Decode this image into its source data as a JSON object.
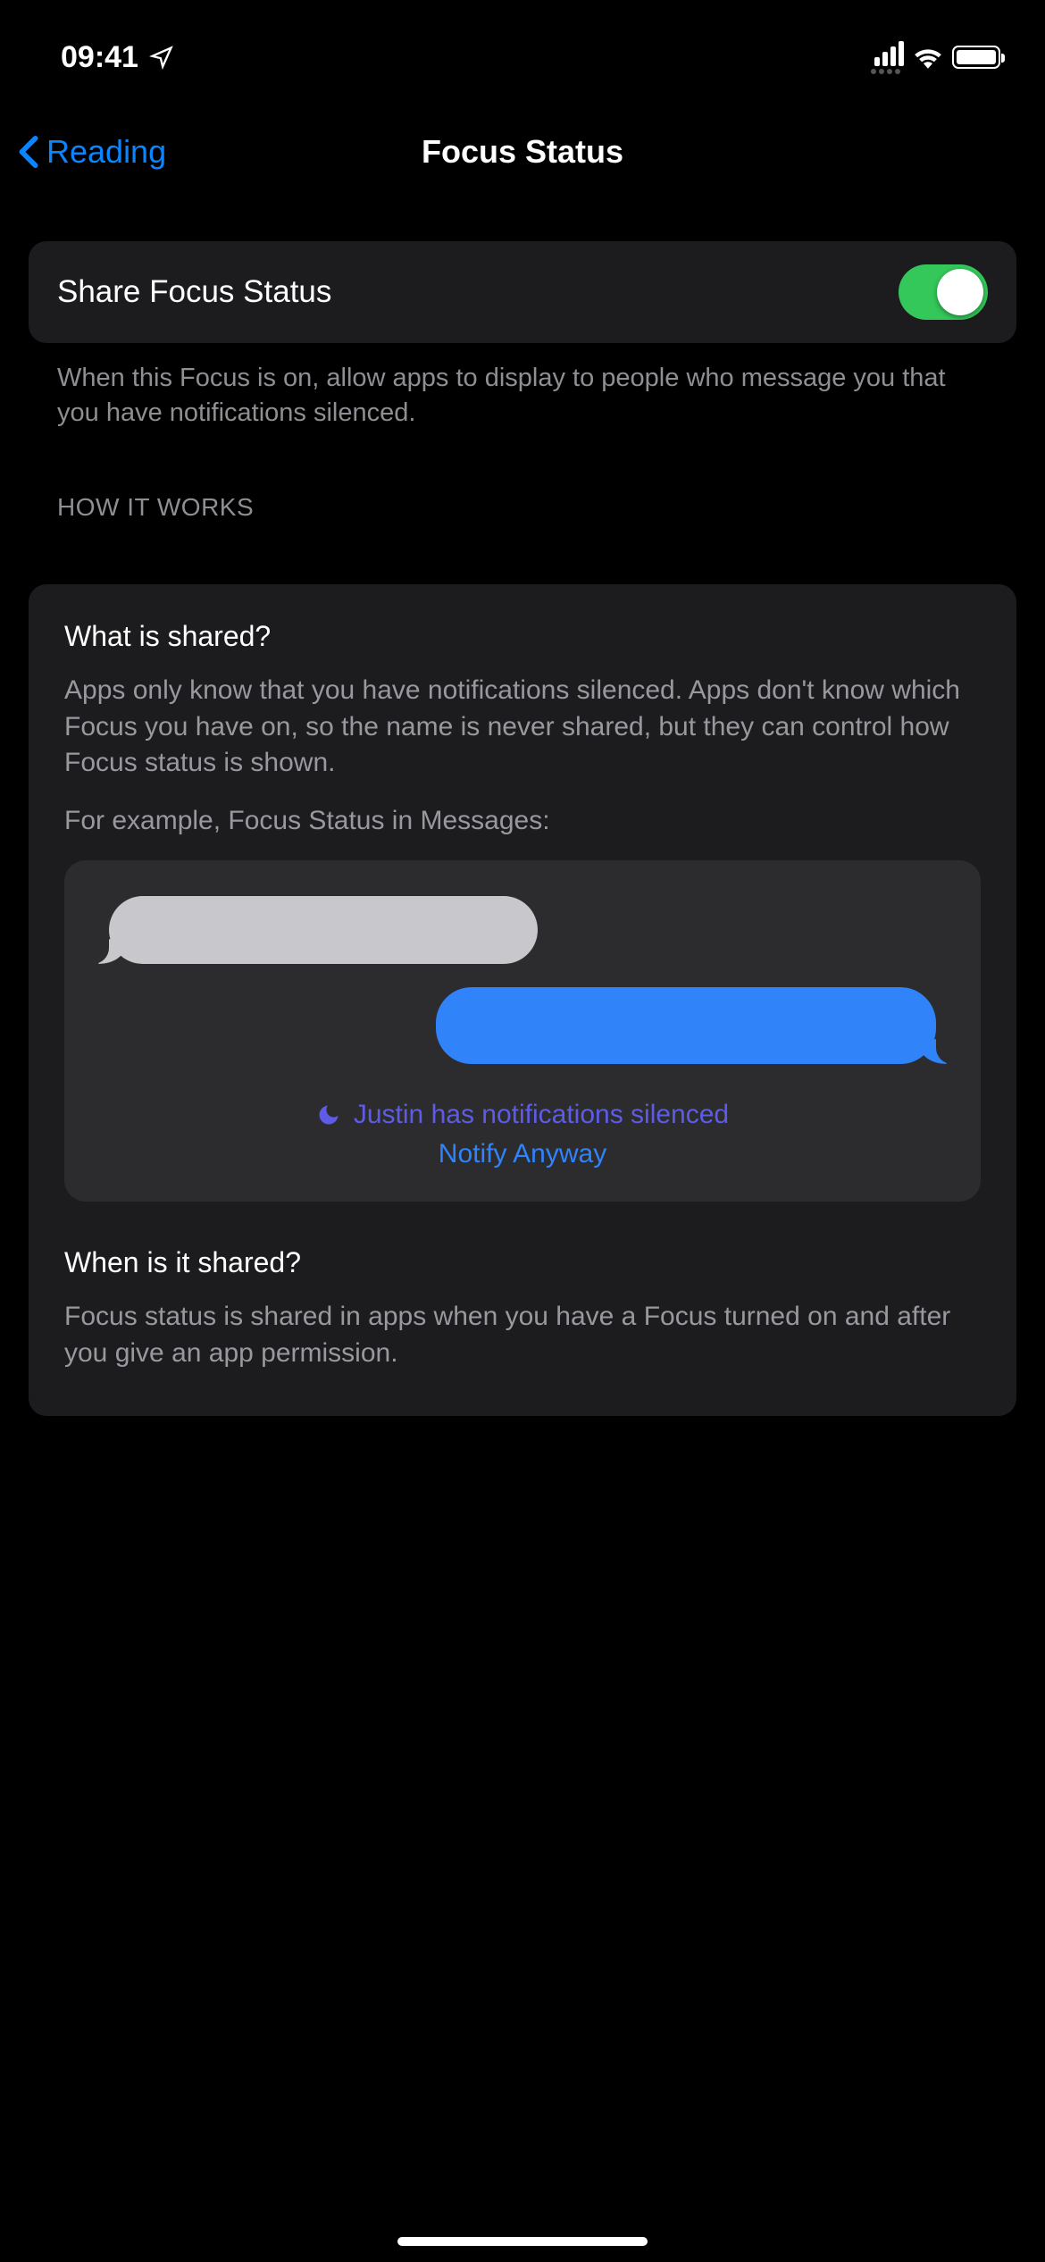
{
  "statusbar": {
    "time": "09:41"
  },
  "nav": {
    "back_label": "Reading",
    "title": "Focus Status"
  },
  "share_cell": {
    "label": "Share Focus Status",
    "enabled": true,
    "footer": "When this Focus is on, allow apps to display to people who message you that you have notifications silenced."
  },
  "how_it_works": {
    "header": "HOW IT WORKS",
    "section1": {
      "title": "What is shared?",
      "body": "Apps only know that you have notifications silenced. Apps don't know which Focus you have on, so the name is never shared, but they can control how Focus status is shown.",
      "example_intro": "For example, Focus Status in Messages:"
    },
    "example": {
      "silenced_text": "Justin has notifications silenced",
      "notify_anyway": "Notify Anyway"
    },
    "section2": {
      "title": "When is it shared?",
      "body": "Focus status is shared in apps when you have a Focus turned on and after you give an app permission."
    }
  }
}
